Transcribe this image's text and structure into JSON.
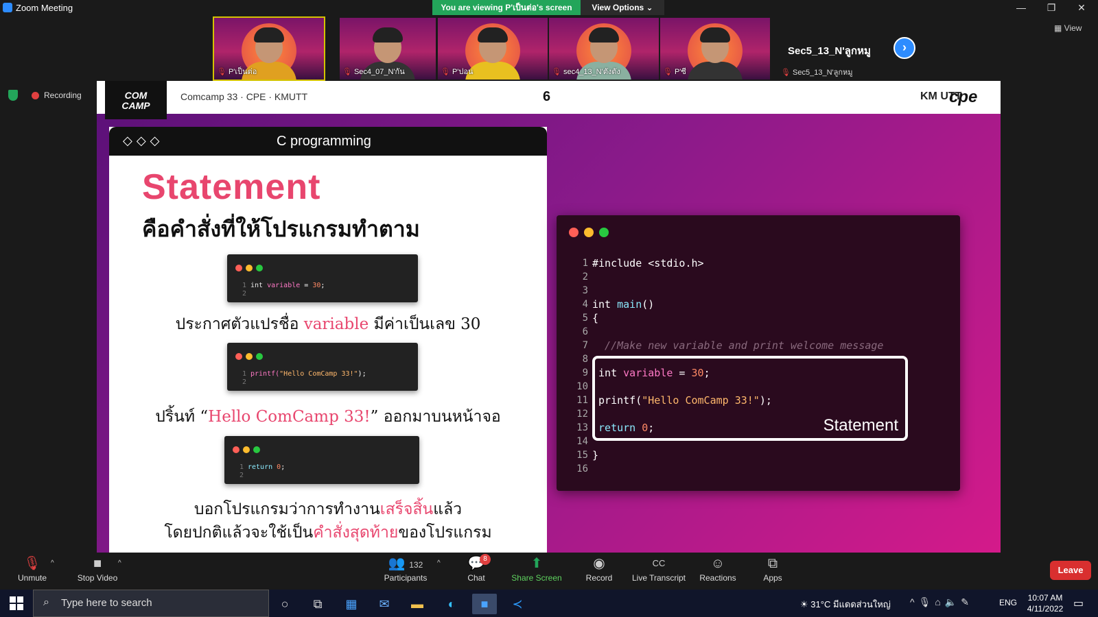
{
  "window": {
    "title": "Zoom Meeting",
    "min": "—",
    "max": "❐",
    "close": "✕"
  },
  "banner": {
    "text": "You are viewing P'เป็นต่อ's screen",
    "view_options": "View Options ⌄"
  },
  "participants": [
    {
      "name": "P'เป็นต่อ",
      "active": true
    },
    {
      "name": "Sec4_07_N'กัน",
      "active": false
    },
    {
      "name": "P'ปอน",
      "active": false
    },
    {
      "name": "sec4_13_N'ตังตัง",
      "active": false
    },
    {
      "name": "P'ซี",
      "active": false
    }
  ],
  "name_tile": {
    "big": "Sec5_13_N'ลูกหมู",
    "small": "Sec5_13_N'ลูกหมู"
  },
  "next_glyph": "›",
  "view_label": "▦ View",
  "recording_label": "Recording",
  "slide": {
    "logo_line1": "COM",
    "logo_line2": "CAMP",
    "header": "Comcamp 33 · CPE · KMUTT",
    "number": "6",
    "kmutt": "KM UTT",
    "cpe": "cpe",
    "card": {
      "diamonds": "◇◇◇",
      "title": "C programming",
      "heading": "Statement",
      "subtitle": "คือคำสั่งที่ให้โปรแกรมทำตาม",
      "snippets": [
        {
          "lines": "1\n2",
          "kw": "int ",
          "var": "variable",
          "op": " = ",
          "num": "30",
          "end": ";"
        },
        {
          "lines": "1\n2",
          "fn": "printf(",
          "str": "\"Hello ComCamp 33!\"",
          "end": ");"
        },
        {
          "lines": "1\n2",
          "ret": "return ",
          "num": "0",
          "end": ";"
        }
      ],
      "desc1_a": "ประกาศตัวแปรชื่อ ",
      "desc1_b": "variable",
      "desc1_c": " มีค่าเป็นเลข 30",
      "desc2_a": "ปริ้นท์ “",
      "desc2_b": "Hello ComCamp 33!",
      "desc2_c": "” ออกมาบนหน้าจอ",
      "desc3_a": "บอกโปรแกรมว่าการทำงาน",
      "desc3_b": "เสร็จสิ้น",
      "desc3_c": "แล้ว",
      "desc4_a": "โดยปกติแล้วจะใช้เป็น",
      "desc4_b": "คำสั่งสุดท้าย",
      "desc4_c": "ของโปรแกรม"
    },
    "editor": {
      "line_numbers": "1\n2\n3\n4\n5\n6\n7\n8\n9\n10\n11\n12\n13\n14\n15\n16",
      "l1": "#include <stdio.h>",
      "l4a": "int ",
      "l4b": "main",
      "l4c": "()",
      "l5": "{",
      "l7": "  //Make new variable and print welcome message",
      "l9a": " int ",
      "l9b": "variable",
      "l9c": " = ",
      "l9d": "30",
      "l9e": ";",
      "l11a": " printf(",
      "l11b": "\"Hello ComCamp 33!\"",
      "l11c": ");",
      "l13a": " return ",
      "l13b": "0",
      "l13c": ";",
      "l15": "}",
      "statement_label": "Statement"
    }
  },
  "toolbar": {
    "unmute": "Unmute",
    "stop_video": "Stop Video",
    "participants_count": "132",
    "participants": "Participants",
    "chat": "Chat",
    "chat_badge": "8",
    "share": "Share Screen",
    "record": "Record",
    "transcript": "Live Transcript",
    "reactions": "Reactions",
    "apps": "Apps",
    "leave": "Leave",
    "caret": "^"
  },
  "taskbar": {
    "search_placeholder": "Type here to search",
    "weather": "31°C มีแดดส่วนใหญ่",
    "lang": "ENG",
    "time": "10:07 AM",
    "date": "4/11/2022"
  },
  "colors": {
    "accent": "#2d8cff",
    "banner": "#23a55a",
    "leave": "#d92f2f",
    "heading_pink": "#e8466e"
  }
}
